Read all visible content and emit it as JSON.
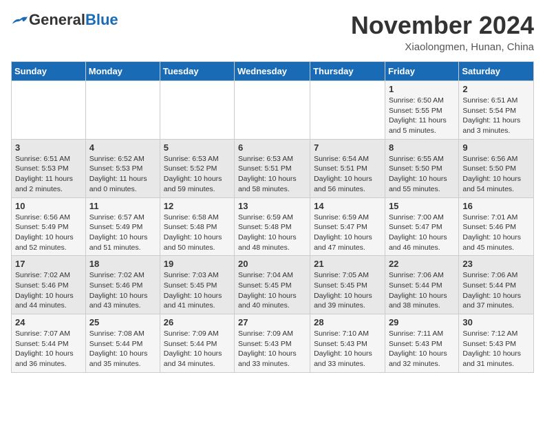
{
  "header": {
    "logo_general": "General",
    "logo_blue": "Blue",
    "month_title": "November 2024",
    "location": "Xiaolongmen, Hunan, China"
  },
  "weekdays": [
    "Sunday",
    "Monday",
    "Tuesday",
    "Wednesday",
    "Thursday",
    "Friday",
    "Saturday"
  ],
  "weeks": [
    [
      {
        "day": "",
        "info": ""
      },
      {
        "day": "",
        "info": ""
      },
      {
        "day": "",
        "info": ""
      },
      {
        "day": "",
        "info": ""
      },
      {
        "day": "",
        "info": ""
      },
      {
        "day": "1",
        "info": "Sunrise: 6:50 AM\nSunset: 5:55 PM\nDaylight: 11 hours\nand 5 minutes."
      },
      {
        "day": "2",
        "info": "Sunrise: 6:51 AM\nSunset: 5:54 PM\nDaylight: 11 hours\nand 3 minutes."
      }
    ],
    [
      {
        "day": "3",
        "info": "Sunrise: 6:51 AM\nSunset: 5:53 PM\nDaylight: 11 hours\nand 2 minutes."
      },
      {
        "day": "4",
        "info": "Sunrise: 6:52 AM\nSunset: 5:53 PM\nDaylight: 11 hours\nand 0 minutes."
      },
      {
        "day": "5",
        "info": "Sunrise: 6:53 AM\nSunset: 5:52 PM\nDaylight: 10 hours\nand 59 minutes."
      },
      {
        "day": "6",
        "info": "Sunrise: 6:53 AM\nSunset: 5:51 PM\nDaylight: 10 hours\nand 58 minutes."
      },
      {
        "day": "7",
        "info": "Sunrise: 6:54 AM\nSunset: 5:51 PM\nDaylight: 10 hours\nand 56 minutes."
      },
      {
        "day": "8",
        "info": "Sunrise: 6:55 AM\nSunset: 5:50 PM\nDaylight: 10 hours\nand 55 minutes."
      },
      {
        "day": "9",
        "info": "Sunrise: 6:56 AM\nSunset: 5:50 PM\nDaylight: 10 hours\nand 54 minutes."
      }
    ],
    [
      {
        "day": "10",
        "info": "Sunrise: 6:56 AM\nSunset: 5:49 PM\nDaylight: 10 hours\nand 52 minutes."
      },
      {
        "day": "11",
        "info": "Sunrise: 6:57 AM\nSunset: 5:49 PM\nDaylight: 10 hours\nand 51 minutes."
      },
      {
        "day": "12",
        "info": "Sunrise: 6:58 AM\nSunset: 5:48 PM\nDaylight: 10 hours\nand 50 minutes."
      },
      {
        "day": "13",
        "info": "Sunrise: 6:59 AM\nSunset: 5:48 PM\nDaylight: 10 hours\nand 48 minutes."
      },
      {
        "day": "14",
        "info": "Sunrise: 6:59 AM\nSunset: 5:47 PM\nDaylight: 10 hours\nand 47 minutes."
      },
      {
        "day": "15",
        "info": "Sunrise: 7:00 AM\nSunset: 5:47 PM\nDaylight: 10 hours\nand 46 minutes."
      },
      {
        "day": "16",
        "info": "Sunrise: 7:01 AM\nSunset: 5:46 PM\nDaylight: 10 hours\nand 45 minutes."
      }
    ],
    [
      {
        "day": "17",
        "info": "Sunrise: 7:02 AM\nSunset: 5:46 PM\nDaylight: 10 hours\nand 44 minutes."
      },
      {
        "day": "18",
        "info": "Sunrise: 7:02 AM\nSunset: 5:46 PM\nDaylight: 10 hours\nand 43 minutes."
      },
      {
        "day": "19",
        "info": "Sunrise: 7:03 AM\nSunset: 5:45 PM\nDaylight: 10 hours\nand 41 minutes."
      },
      {
        "day": "20",
        "info": "Sunrise: 7:04 AM\nSunset: 5:45 PM\nDaylight: 10 hours\nand 40 minutes."
      },
      {
        "day": "21",
        "info": "Sunrise: 7:05 AM\nSunset: 5:45 PM\nDaylight: 10 hours\nand 39 minutes."
      },
      {
        "day": "22",
        "info": "Sunrise: 7:06 AM\nSunset: 5:44 PM\nDaylight: 10 hours\nand 38 minutes."
      },
      {
        "day": "23",
        "info": "Sunrise: 7:06 AM\nSunset: 5:44 PM\nDaylight: 10 hours\nand 37 minutes."
      }
    ],
    [
      {
        "day": "24",
        "info": "Sunrise: 7:07 AM\nSunset: 5:44 PM\nDaylight: 10 hours\nand 36 minutes."
      },
      {
        "day": "25",
        "info": "Sunrise: 7:08 AM\nSunset: 5:44 PM\nDaylight: 10 hours\nand 35 minutes."
      },
      {
        "day": "26",
        "info": "Sunrise: 7:09 AM\nSunset: 5:44 PM\nDaylight: 10 hours\nand 34 minutes."
      },
      {
        "day": "27",
        "info": "Sunrise: 7:09 AM\nSunset: 5:43 PM\nDaylight: 10 hours\nand 33 minutes."
      },
      {
        "day": "28",
        "info": "Sunrise: 7:10 AM\nSunset: 5:43 PM\nDaylight: 10 hours\nand 33 minutes."
      },
      {
        "day": "29",
        "info": "Sunrise: 7:11 AM\nSunset: 5:43 PM\nDaylight: 10 hours\nand 32 minutes."
      },
      {
        "day": "30",
        "info": "Sunrise: 7:12 AM\nSunset: 5:43 PM\nDaylight: 10 hours\nand 31 minutes."
      }
    ]
  ]
}
